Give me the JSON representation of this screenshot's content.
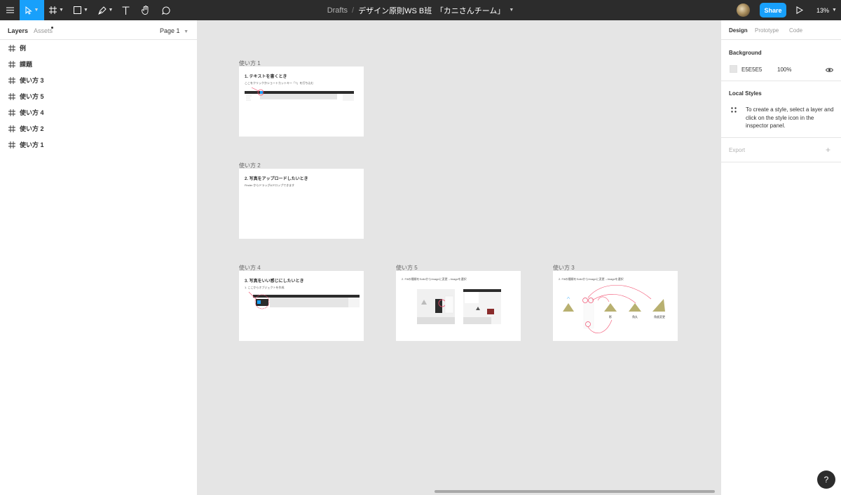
{
  "toolbar": {
    "breadcrumb_drafts": "Drafts",
    "breadcrumb_sep": "/",
    "file_name": "デザイン原則WS B班　「カニさんチーム」",
    "share_label": "Share",
    "zoom": "13%"
  },
  "left_panel": {
    "tabs": {
      "layers": "Layers",
      "assets": "Assets"
    },
    "page": "Page 1",
    "layers": [
      "例",
      "課題",
      "使い方 3",
      "使い方 5",
      "使い方 4",
      "使い方 2",
      "使い方 1"
    ]
  },
  "canvas": {
    "background": "#E5E5E5",
    "frames": [
      {
        "label": "使い方 1",
        "heading": "1. テキストを書くとき",
        "sub": "ここをクリックかショートカットキー「T」を打ち込む"
      },
      {
        "label": "使い方 2",
        "heading": "2. 写真をアップロードしたいとき",
        "sub": "Finder からドラッグ&ドロップできます"
      },
      {
        "label": "使い方 4",
        "heading": "3. 写真をいい感じにしたいとき",
        "sub": "1. ここからオブジェクトを作成"
      },
      {
        "label": "使い方 5",
        "heading": "2. Fillの種類をSolidからImageに変更→Imageを選択",
        "sub": ""
      },
      {
        "label": "使い方 3",
        "heading": "2. Fillの種類をSolidからImageに変更→Imageを選択",
        "sub": "",
        "captions": [
          "影",
          "角丸",
          "角度変更"
        ]
      }
    ]
  },
  "right_panel": {
    "tabs": {
      "design": "Design",
      "prototype": "Prototype",
      "code": "Code"
    },
    "background_title": "Background",
    "background_hex": "E5E5E5",
    "background_opacity": "100%",
    "local_styles_title": "Local Styles",
    "local_styles_help": "To create a style, select a layer and click on the style icon in the inspector panel.",
    "export_title": "Export"
  },
  "help_label": "?",
  "colors": {
    "toolbar": "#2C2C2C",
    "accent": "#18A0FB",
    "canvas": "#E5E5E5",
    "annotation": "#F24E6E"
  }
}
